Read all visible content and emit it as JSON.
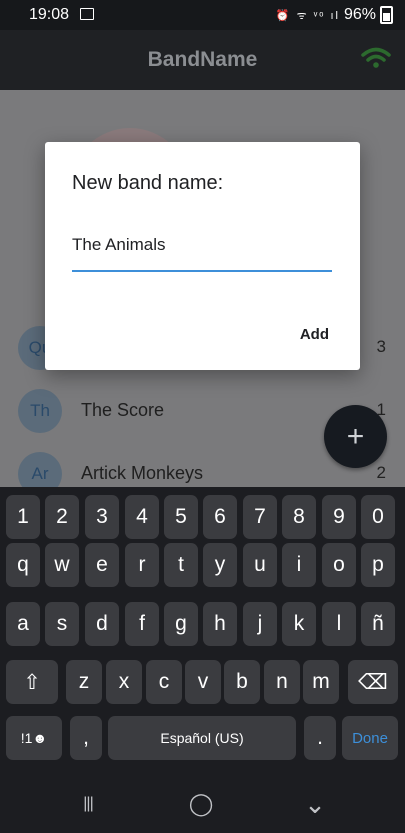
{
  "status": {
    "time": "19:08",
    "icons": "⏰ ᯤ ᵛᵒ ıl",
    "battery": "96%"
  },
  "app": {
    "title": "BandName"
  },
  "bands": [
    {
      "initials": "Qu",
      "name": "",
      "votes": "3"
    },
    {
      "initials": "Th",
      "name": "The Score",
      "votes": "1"
    },
    {
      "initials": "Ar",
      "name": "Artick Monkeys",
      "votes": "2"
    }
  ],
  "fab": {
    "label": "+"
  },
  "dialog": {
    "title": "New band name:",
    "input_value": "The Animals",
    "add_label": "Add"
  },
  "keyboard": {
    "row1": [
      "1",
      "2",
      "3",
      "4",
      "5",
      "6",
      "7",
      "8",
      "9",
      "0"
    ],
    "row2": [
      "q",
      "w",
      "e",
      "r",
      "t",
      "y",
      "u",
      "i",
      "o",
      "p"
    ],
    "row3": [
      "a",
      "s",
      "d",
      "f",
      "g",
      "h",
      "j",
      "k",
      "l",
      "ñ"
    ],
    "row4": [
      "z",
      "x",
      "c",
      "v",
      "b",
      "n",
      "m"
    ],
    "shift": "⇧",
    "backspace": "⌫",
    "symbols": "!1☻",
    "comma": ",",
    "space_label": "Español (US)",
    "period": ".",
    "done": "Done"
  },
  "nav": {
    "recent": "|||",
    "home": "◯",
    "back": "⌄"
  }
}
